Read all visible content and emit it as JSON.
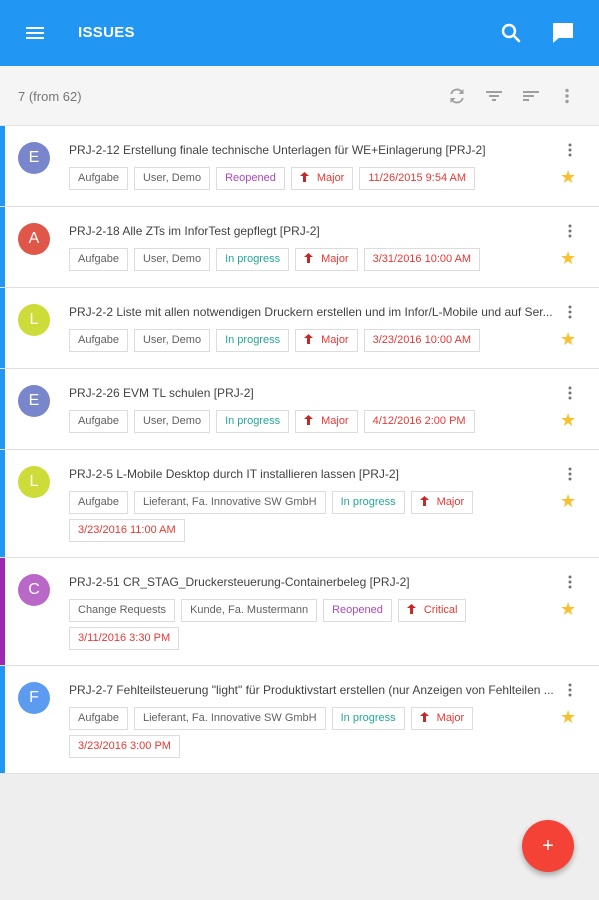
{
  "appbar": {
    "title": "ISSUES",
    "menu_icon": "menu-icon",
    "search_icon": "search-icon",
    "chat_icon": "chat-icon"
  },
  "subbar": {
    "count": "7 (from 62)"
  },
  "colors": {
    "primary": "#2196f3",
    "accent": "#f44336",
    "star": "#fbc02d",
    "reopened": "#ab47bc",
    "in_progress": "#26a69a",
    "priority": "#e53935"
  },
  "issues": [
    {
      "avatar": "E",
      "avatar_color": "#7986cb",
      "bar_color": "#2196f3",
      "summary": "PRJ-2-12 Erstellung finale technische Unterlagen für WE+Einlagerung [PRJ-2]",
      "type": "Aufgabe",
      "assignee": "User, Demo",
      "status": "Reopened",
      "status_class": "reopened",
      "priority": "Major",
      "date": "11/26/2015 9:54 AM"
    },
    {
      "avatar": "A",
      "avatar_color": "#e0574a",
      "bar_color": "#2196f3",
      "summary": "PRJ-2-18 Alle ZTs im InforTest gepflegt [PRJ-2]",
      "type": "Aufgabe",
      "assignee": "User, Demo",
      "status": "In progress",
      "status_class": "progress",
      "priority": "Major",
      "date": "3/31/2016 10:00 AM"
    },
    {
      "avatar": "L",
      "avatar_color": "#cddc39",
      "bar_color": "#2196f3",
      "summary": "PRJ-2-2 Liste mit allen notwendigen Druckern erstellen und im Infor/L-Mobile und auf Ser...",
      "type": "Aufgabe",
      "assignee": "User, Demo",
      "status": "In progress",
      "status_class": "progress",
      "priority": "Major",
      "date": "3/23/2016 10:00 AM"
    },
    {
      "avatar": "E",
      "avatar_color": "#7986cb",
      "bar_color": "#2196f3",
      "summary": "PRJ-2-26 EVM TL schulen [PRJ-2]",
      "type": "Aufgabe",
      "assignee": "User, Demo",
      "status": "In progress",
      "status_class": "progress",
      "priority": "Major",
      "date": "4/12/2016 2:00 PM"
    },
    {
      "avatar": "L",
      "avatar_color": "#cddc39",
      "bar_color": "#2196f3",
      "summary": "PRJ-2-5 L-Mobile Desktop durch IT installieren lassen [PRJ-2]",
      "type": "Aufgabe",
      "assignee": "Lieferant, Fa. Innovative SW GmbH",
      "status": "In progress",
      "status_class": "progress",
      "priority": "Major",
      "date": "3/23/2016 11:00 AM"
    },
    {
      "avatar": "C",
      "avatar_color": "#ba68c8",
      "bar_color": "#9c27b0",
      "summary": "PRJ-2-51 CR_STAG_Druckersteuerung-Containerbeleg [PRJ-2]",
      "type": "Change Requests",
      "assignee": "Kunde, Fa. Mustermann",
      "status": "Reopened",
      "status_class": "reopened",
      "priority": "Critical",
      "date": "3/11/2016 3:30 PM"
    },
    {
      "avatar": "F",
      "avatar_color": "#5c9bf0",
      "bar_color": "#2196f3",
      "summary": "PRJ-2-7 Fehlteilsteuerung \"light\" für Produktivstart erstellen (nur Anzeigen von Fehlteilen ...",
      "type": "Aufgabe",
      "assignee": "Lieferant, Fa. Innovative SW GmbH",
      "status": "In progress",
      "status_class": "progress",
      "priority": "Major",
      "date": "3/23/2016 3:00 PM"
    }
  ],
  "fab": {
    "label": "+"
  }
}
